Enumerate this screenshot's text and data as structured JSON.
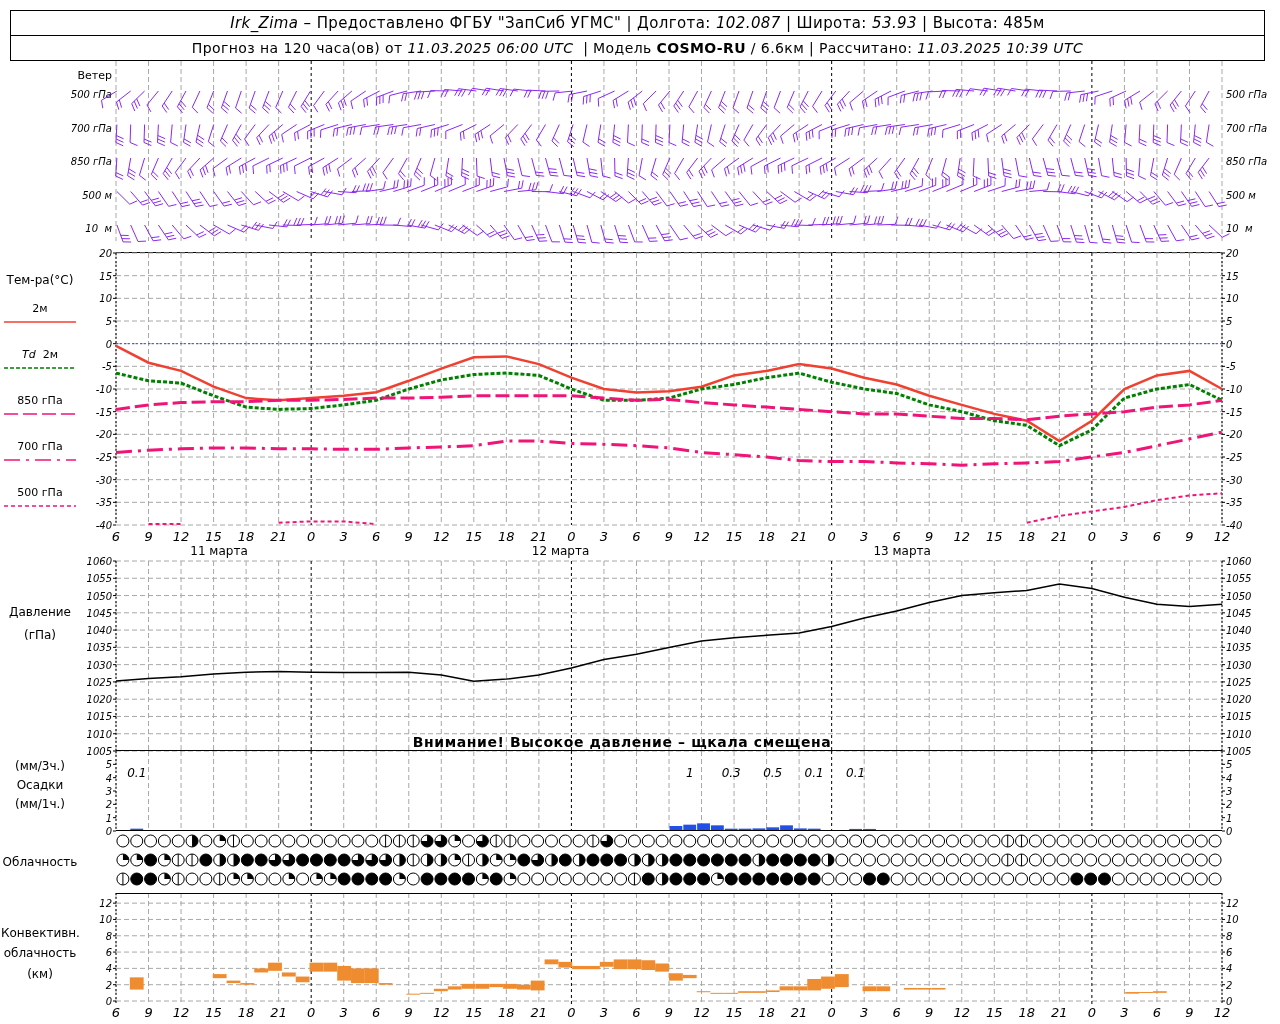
{
  "header": {
    "line_1": "*Irk_Zima* – Предоставлено ФГБУ \"ЗапСиб УГМС\" | Долгота: *102.087* | Широта: *53.93* | Высота: 485м",
    "line_2": "Прогноз на 120 часа(ов) от *11.03.2025 06:00 UTC*  | Модель **COSMO-RU** / 6.6км | Рассчитано: *11.03.2025 10:39 UTC*"
  },
  "wind": {
    "title": "Ветер",
    "rows": [
      {
        "label_left": "500 гПа",
        "label_right": "500 гПа"
      },
      {
        "label_left": "700 гПа",
        "label_right": "700 гПа"
      },
      {
        "label_left": "850 гПа",
        "label_right": "850 гПа"
      },
      {
        "label_left": "500 м",
        "label_right": "500 м"
      },
      {
        "label_left": "10  м",
        "label_right": "10  м"
      }
    ]
  },
  "temperature": {
    "right_axis_labels": [
      "20",
      "15",
      "10",
      "5",
      "0",
      "-5",
      "-10",
      "-15",
      "-20",
      "-25",
      "-30",
      "-35",
      "-40"
    ],
    "dates": [
      "11 марта",
      "12 марта",
      "13 марта"
    ],
    "chart_data": {
      "type": "line",
      "title": "Тем-ра(°C)",
      "grid": true,
      "ref_lines": [
        {
          "axis": "y",
          "value": 0,
          "color": "#3050ff"
        }
      ],
      "ylim": [
        -40,
        20
      ],
      "yticks": [
        20,
        15,
        10,
        5,
        0,
        -5,
        -10,
        -15,
        -20,
        -25,
        -30,
        -35,
        -40
      ],
      "categories": [
        "6",
        "9",
        "12",
        "15",
        "18",
        "21",
        "0",
        "3",
        "6",
        "9",
        "12",
        "15",
        "18",
        "21",
        "0",
        "3",
        "6",
        "9",
        "12",
        "15",
        "18",
        "21",
        "0",
        "3",
        "6",
        "9",
        "12",
        "15",
        "18",
        "21",
        "0",
        "3",
        "6",
        "9",
        "12"
      ],
      "series": [
        {
          "name": "2м",
          "color": "#f04030",
          "line_style": "solid",
          "values": [
            -0.5,
            -4.2,
            -6,
            -9.5,
            -12,
            -12.5,
            -12,
            -11.5,
            -10.7,
            -8.2,
            -5.5,
            -3,
            -2.8,
            -4.5,
            -7.5,
            -10,
            -10.8,
            -10.5,
            -9.5,
            -7,
            -6,
            -4.5,
            -5.5,
            -7.5,
            -9,
            -11.5,
            -13.5,
            -15.5,
            -17,
            -21.5,
            -17,
            -10,
            -7,
            -6,
            -10
          ]
        },
        {
          "name": "*Td*  2м",
          "color": "#008000",
          "line_style": "dotted",
          "values": [
            -6.5,
            -8.2,
            -8.7,
            -11.5,
            -14,
            -14.5,
            -14.3,
            -13.5,
            -12.5,
            -10,
            -8,
            -6.8,
            -6.5,
            -7,
            -10,
            -12.5,
            -12.5,
            -12,
            -10,
            -9,
            -7.5,
            -6.5,
            -8.5,
            -10,
            -11,
            -13.5,
            -15,
            -17,
            -18,
            -22.5,
            -19,
            -12,
            -10,
            -9,
            -12.5
          ]
        },
        {
          "name": "850 гПа",
          "color": "#f01478",
          "line_style": "dashed",
          "values": [
            -14.5,
            -13.5,
            -13,
            -12.8,
            -12.8,
            -12.5,
            -12.5,
            -12.3,
            -12,
            -12,
            -11.8,
            -11.5,
            -11.5,
            -11.5,
            -11.5,
            -12,
            -12.5,
            -12.3,
            -13,
            -13.5,
            -14,
            -14.5,
            -15,
            -15.5,
            -15.5,
            -16,
            -16.5,
            -16.5,
            -16.8,
            -16,
            -15.5,
            -15,
            -14,
            -13.5,
            -12.5
          ]
        },
        {
          "name": "700 гПа",
          "color": "#f01478",
          "line_style": "dashdot",
          "values": [
            -24,
            -23.5,
            -23.2,
            -23,
            -23,
            -23.2,
            -23.2,
            -23.3,
            -23.3,
            -23,
            -22.8,
            -22.5,
            -21.5,
            -21.5,
            -22,
            -22.2,
            -22.5,
            -23,
            -24,
            -24.5,
            -25,
            -25.8,
            -26,
            -26,
            -26.3,
            -26.5,
            -26.8,
            -26.5,
            -26.3,
            -26,
            -25,
            -24,
            -22.5,
            -21,
            -19.5
          ]
        },
        {
          "name": "500 гПа",
          "color": "#f01478",
          "line_style": "fine",
          "values": [
            null,
            -39.8,
            -39.8,
            null,
            null,
            -39.5,
            -39.2,
            -39.2,
            -39.8,
            null,
            null,
            null,
            null,
            null,
            null,
            null,
            null,
            null,
            null,
            null,
            null,
            null,
            null,
            null,
            null,
            null,
            null,
            null,
            -39.5,
            -38,
            -37,
            -36,
            -34.5,
            -33.5,
            -33
          ]
        }
      ]
    }
  },
  "pressure": {
    "right_axis_labels": [
      "1060",
      "1055",
      "1050",
      "1045",
      "1040",
      "1035",
      "1030",
      "1025",
      "1020",
      "1015",
      "1010",
      "1005"
    ],
    "chart_data": {
      "type": "line",
      "title": "Давление",
      "ylabel": "(гПа)",
      "grid": true,
      "ylim": [
        1005,
        1060
      ],
      "yticks": [
        1060,
        1055,
        1050,
        1045,
        1040,
        1035,
        1030,
        1025,
        1020,
        1015,
        1010,
        1005
      ],
      "series": [
        {
          "values": [
            1025.3,
            1026,
            1026.5,
            1027.3,
            1027.8,
            1028,
            1027.8,
            1027.7,
            1027.7,
            1027.8,
            1027,
            1025.2,
            1025.8,
            1027,
            1029,
            1031.5,
            1033,
            1035,
            1036.8,
            1037.8,
            1038.5,
            1039.2,
            1041,
            1043.5,
            1045.5,
            1048,
            1050,
            1050.8,
            1051.5,
            1053.3,
            1052,
            1049.5,
            1047.5,
            1046.8,
            1047.5
          ]
        }
      ]
    },
    "warning": "Внимание! Высокое давление – щкала смещена"
  },
  "precipitation": {
    "label_top": "(мм/3ч.)",
    "right_axis_labels": [
      "5",
      "4",
      "3",
      "2",
      "1",
      "0"
    ],
    "chart_data": {
      "type": "bar",
      "title": "Осадки",
      "ylabel": "(мм/1ч.)",
      "grid": true,
      "ylim": [
        0,
        6
      ],
      "yticks": [
        0,
        1,
        2,
        3,
        4,
        5
      ],
      "values": [
        0,
        0.1,
        0,
        0,
        0,
        0,
        0,
        0,
        0,
        0,
        0,
        0,
        0,
        0,
        0,
        0,
        0,
        0,
        0,
        0,
        0,
        0,
        0,
        0,
        0,
        0,
        0,
        0,
        0,
        0,
        0,
        0,
        0,
        0,
        0,
        0,
        0,
        0,
        0,
        0,
        0.3,
        0.4,
        0.5,
        0.35,
        0.1,
        0.1,
        0.12,
        0.2,
        0.35,
        0.12,
        0.1,
        0,
        0,
        0.08,
        0.08,
        0,
        0,
        0,
        0,
        0,
        0,
        0,
        0,
        0,
        0,
        0,
        0,
        0,
        0,
        0,
        0,
        0,
        0,
        0,
        0,
        0,
        0,
        0,
        0,
        0
      ],
      "annotations": [
        "0.1",
        "1",
        "0.3",
        "0.5",
        "0.1",
        "0.1"
      ]
    }
  },
  "cloudiness": {
    "label": "Облачность",
    "rows": [
      {
        "cells": [
          {
            "kind": "clear"
          },
          {
            "kind": "clear"
          },
          {
            "kind": "clear"
          },
          {
            "kind": "clear"
          },
          {
            "kind": "clear"
          },
          {
            "kind": "half"
          },
          {
            "kind": "clear"
          },
          {
            "kind": "quarter"
          },
          {
            "kind": "line"
          },
          {
            "kind": "clear"
          },
          {
            "kind": "clear"
          },
          {
            "kind": "clear"
          },
          {
            "kind": "clear"
          },
          {
            "kind": "clear"
          },
          {
            "kind": "clear"
          },
          {
            "kind": "clear"
          },
          {
            "kind": "clear"
          },
          {
            "kind": "clear"
          },
          {
            "kind": "clear"
          },
          {
            "kind": "line"
          },
          {
            "kind": "line"
          },
          {
            "kind": "line"
          },
          {
            "kind": "threequarter"
          },
          {
            "kind": "threequarter"
          },
          {
            "kind": "quarter"
          },
          {
            "kind": "clear"
          },
          {
            "kind": "threequarter"
          },
          {
            "kind": "line"
          },
          {
            "kind": "line"
          },
          {
            "kind": "clear"
          },
          {
            "kind": "clear"
          },
          {
            "kind": "clear"
          },
          {
            "kind": "clear"
          },
          {
            "kind": "clear"
          },
          {
            "kind": "line"
          },
          {
            "kind": "threequarter"
          },
          {
            "kind": "clear"
          },
          {
            "kind": "clear"
          },
          {
            "kind": "clear"
          },
          {
            "kind": "clear"
          },
          {
            "kind": "clear"
          },
          {
            "kind": "clear"
          },
          {
            "kind": "clear"
          },
          {
            "kind": "clear"
          },
          {
            "kind": "clear"
          },
          {
            "kind": "clear"
          },
          {
            "kind": "clear"
          },
          {
            "kind": "clear"
          },
          {
            "kind": "clear"
          },
          {
            "kind": "clear"
          },
          {
            "kind": "clear"
          },
          {
            "kind": "clear"
          },
          {
            "kind": "clear"
          },
          {
            "kind": "clear"
          },
          {
            "kind": "clear"
          },
          {
            "kind": "clear"
          },
          {
            "kind": "clear"
          },
          {
            "kind": "clear"
          },
          {
            "kind": "clear"
          },
          {
            "kind": "clear"
          },
          {
            "kind": "clear"
          },
          {
            "kind": "clear"
          },
          {
            "kind": "clear"
          },
          {
            "kind": "clear"
          },
          {
            "kind": "line"
          },
          {
            "kind": "line"
          },
          {
            "kind": "clear"
          },
          {
            "kind": "clear"
          },
          {
            "kind": "clear"
          },
          {
            "kind": "clear"
          },
          {
            "kind": "clear"
          },
          {
            "kind": "clear"
          },
          {
            "kind": "clear"
          },
          {
            "kind": "clear"
          },
          {
            "kind": "clear"
          },
          {
            "kind": "clear"
          },
          {
            "kind": "clear"
          },
          {
            "kind": "clear"
          },
          {
            "kind": "clear"
          },
          {
            "kind": "clear"
          }
        ]
      },
      {
        "cells": [
          {
            "kind": "quarter"
          },
          {
            "kind": "quarter"
          },
          {
            "kind": "full"
          },
          {
            "kind": "quarter"
          },
          {
            "kind": "line"
          },
          {
            "kind": "line"
          },
          {
            "kind": "full"
          },
          {
            "kind": "half"
          },
          {
            "kind": "half"
          },
          {
            "kind": "full"
          },
          {
            "kind": "full"
          },
          {
            "kind": "threequarter"
          },
          {
            "kind": "threequarter"
          },
          {
            "kind": "full"
          },
          {
            "kind": "full"
          },
          {
            "kind": "full"
          },
          {
            "kind": "full"
          },
          {
            "kind": "threequarter"
          },
          {
            "kind": "threequarter"
          },
          {
            "kind": "threequarter"
          },
          {
            "kind": "half"
          },
          {
            "kind": "line"
          },
          {
            "kind": "half"
          },
          {
            "kind": "half"
          },
          {
            "kind": "quarter"
          },
          {
            "kind": "line"
          },
          {
            "kind": "half"
          },
          {
            "kind": "quarter"
          },
          {
            "kind": "quarter"
          },
          {
            "kind": "full"
          },
          {
            "kind": "threequarter"
          },
          {
            "kind": "half"
          },
          {
            "kind": "full"
          },
          {
            "kind": "half"
          },
          {
            "kind": "full"
          },
          {
            "kind": "full"
          },
          {
            "kind": "full"
          },
          {
            "kind": "half"
          },
          {
            "kind": "half"
          },
          {
            "kind": "half"
          },
          {
            "kind": "full"
          },
          {
            "kind": "full"
          },
          {
            "kind": "full"
          },
          {
            "kind": "full"
          },
          {
            "kind": "full"
          },
          {
            "kind": "full"
          },
          {
            "kind": "half"
          },
          {
            "kind": "full"
          },
          {
            "kind": "full"
          },
          {
            "kind": "full"
          },
          {
            "kind": "full"
          },
          {
            "kind": "half"
          },
          {
            "kind": "clear"
          },
          {
            "kind": "clear"
          },
          {
            "kind": "clear"
          },
          {
            "kind": "clear"
          },
          {
            "kind": "clear"
          },
          {
            "kind": "clear"
          },
          {
            "kind": "clear"
          },
          {
            "kind": "clear"
          },
          {
            "kind": "clear"
          },
          {
            "kind": "clear"
          },
          {
            "kind": "clear"
          },
          {
            "kind": "clear"
          },
          {
            "kind": "line"
          },
          {
            "kind": "line"
          },
          {
            "kind": "clear"
          },
          {
            "kind": "clear"
          },
          {
            "kind": "clear"
          },
          {
            "kind": "clear"
          },
          {
            "kind": "clear"
          },
          {
            "kind": "clear"
          },
          {
            "kind": "clear"
          },
          {
            "kind": "clear"
          },
          {
            "kind": "clear"
          },
          {
            "kind": "clear"
          },
          {
            "kind": "clear"
          },
          {
            "kind": "clear"
          },
          {
            "kind": "clear"
          },
          {
            "kind": "clear"
          }
        ]
      },
      {
        "cells": [
          {
            "kind": "line"
          },
          {
            "kind": "full"
          },
          {
            "kind": "full"
          },
          {
            "kind": "quarter"
          },
          {
            "kind": "line"
          },
          {
            "kind": "clear"
          },
          {
            "kind": "clear"
          },
          {
            "kind": "line"
          },
          {
            "kind": "quarter"
          },
          {
            "kind": "quarter"
          },
          {
            "kind": "clear"
          },
          {
            "kind": "clear"
          },
          {
            "kind": "quarter"
          },
          {
            "kind": "clear"
          },
          {
            "kind": "quarter"
          },
          {
            "kind": "quarter"
          },
          {
            "kind": "full"
          },
          {
            "kind": "full"
          },
          {
            "kind": "full"
          },
          {
            "kind": "full"
          },
          {
            "kind": "quarter"
          },
          {
            "kind": "clear"
          },
          {
            "kind": "full"
          },
          {
            "kind": "full"
          },
          {
            "kind": "full"
          },
          {
            "kind": "full"
          },
          {
            "kind": "quarter"
          },
          {
            "kind": "full"
          },
          {
            "kind": "quarter"
          },
          {
            "kind": "clear"
          },
          {
            "kind": "clear"
          },
          {
            "kind": "clear"
          },
          {
            "kind": "clear"
          },
          {
            "kind": "clear"
          },
          {
            "kind": "clear"
          },
          {
            "kind": "clear"
          },
          {
            "kind": "clear"
          },
          {
            "kind": "line"
          },
          {
            "kind": "full"
          },
          {
            "kind": "half"
          },
          {
            "kind": "full"
          },
          {
            "kind": "full"
          },
          {
            "kind": "full"
          },
          {
            "kind": "quarter"
          },
          {
            "kind": "full"
          },
          {
            "kind": "full"
          },
          {
            "kind": "full"
          },
          {
            "kind": "full"
          },
          {
            "kind": "full"
          },
          {
            "kind": "full"
          },
          {
            "kind": "full"
          },
          {
            "kind": "clear"
          },
          {
            "kind": "clear"
          },
          {
            "kind": "clear"
          },
          {
            "kind": "full"
          },
          {
            "kind": "full"
          },
          {
            "kind": "clear"
          },
          {
            "kind": "clear"
          },
          {
            "kind": "clear"
          },
          {
            "kind": "clear"
          },
          {
            "kind": "clear"
          },
          {
            "kind": "clear"
          },
          {
            "kind": "clear"
          },
          {
            "kind": "clear"
          },
          {
            "kind": "clear"
          },
          {
            "kind": "clear"
          },
          {
            "kind": "clear"
          },
          {
            "kind": "clear"
          },
          {
            "kind": "clear"
          },
          {
            "kind": "full"
          },
          {
            "kind": "full"
          },
          {
            "kind": "full"
          },
          {
            "kind": "clear"
          },
          {
            "kind": "clear"
          },
          {
            "kind": "clear"
          },
          {
            "kind": "clear"
          },
          {
            "kind": "clear"
          },
          {
            "kind": "clear"
          },
          {
            "kind": "clear"
          },
          {
            "kind": "clear"
          }
        ]
      }
    ]
  },
  "convective": {
    "right_axis_labels": [
      "12",
      "10",
      "8",
      "6",
      "4",
      "2",
      "0"
    ],
    "axis_labels": [
      "6",
      "9",
      "12",
      "15",
      "18",
      "21",
      "0",
      "3",
      "6",
      "9",
      "12",
      "15",
      "18",
      "21",
      "0",
      "3",
      "6",
      "9",
      "12",
      "15",
      "18",
      "21",
      "0",
      "3",
      "6",
      "9",
      "12",
      "15",
      "18",
      "21",
      "0",
      "3",
      "6",
      "9",
      "12"
    ],
    "chart_data": {
      "type": "candlestick",
      "title": "Конвективн. облачность",
      "ylabel": "(км)",
      "grid": true,
      "ylim": [
        0,
        13
      ],
      "yticks": [
        0,
        2,
        4,
        6,
        8,
        10,
        12
      ],
      "ohlc": [
        null,
        [
          1.4,
          2.9,
          1.4,
          2.9
        ],
        null,
        null,
        null,
        null,
        null,
        [
          2.8,
          3.3,
          2.8,
          3.3
        ],
        [
          2.2,
          2.5,
          2.2,
          2.5
        ],
        [
          2.0,
          2.2,
          2.0,
          2.2
        ],
        [
          3.5,
          4.0,
          3.5,
          4.0
        ],
        [
          3.7,
          4.7,
          3.7,
          4.7
        ],
        [
          3.0,
          3.5,
          3.0,
          3.5
        ],
        [
          2.3,
          3.0,
          2.3,
          3.0
        ],
        [
          3.6,
          4.7,
          3.6,
          4.7
        ],
        [
          3.6,
          4.7,
          3.6,
          4.7
        ],
        [
          2.5,
          4.3,
          2.5,
          4.3
        ],
        [
          2.2,
          4.0,
          2.2,
          4.0
        ],
        [
          2.2,
          4.0,
          2.2,
          4.0
        ],
        [
          2.0,
          2.2,
          2.0,
          2.2
        ],
        null,
        [
          0.8,
          0.9,
          0.8,
          0.9
        ],
        [
          0.9,
          1.0,
          0.9,
          1.0
        ],
        [
          1.2,
          1.5,
          1.2,
          1.5
        ],
        [
          1.4,
          1.8,
          1.4,
          1.8
        ],
        [
          1.5,
          2.1,
          1.5,
          2.1
        ],
        [
          1.5,
          2.1,
          1.5,
          2.1
        ],
        [
          1.7,
          2.1,
          1.7,
          2.1
        ],
        [
          1.5,
          2.1,
          1.5,
          2.1
        ],
        [
          1.4,
          2.0,
          1.4,
          2.0
        ],
        [
          1.3,
          2.5,
          1.3,
          2.5
        ],
        [
          4.5,
          5.1,
          4.5,
          5.1
        ],
        [
          4.1,
          4.8,
          4.1,
          4.8
        ],
        [
          3.9,
          4.3,
          3.9,
          4.3
        ],
        [
          3.9,
          4.3,
          3.9,
          4.3
        ],
        [
          4.2,
          4.8,
          4.2,
          4.8
        ],
        [
          3.9,
          5.1,
          3.9,
          5.1
        ],
        [
          3.9,
          5.1,
          3.9,
          5.1
        ],
        [
          3.8,
          5.0,
          3.8,
          5.0
        ],
        [
          3.6,
          4.6,
          3.6,
          4.6
        ],
        [
          2.5,
          3.4,
          2.5,
          3.4
        ],
        [
          2.8,
          3.2,
          2.8,
          3.2
        ],
        [
          1.1,
          1.2,
          1.1,
          1.2
        ],
        [
          0.9,
          1.0,
          0.9,
          1.0
        ],
        [
          0.9,
          1.0,
          0.9,
          1.0
        ],
        [
          1.0,
          1.2,
          1.0,
          1.2
        ],
        [
          1.0,
          1.2,
          1.0,
          1.2
        ],
        [
          1.1,
          1.3,
          1.1,
          1.3
        ],
        [
          1.3,
          1.8,
          1.3,
          1.8
        ],
        [
          1.3,
          1.8,
          1.3,
          1.8
        ],
        [
          1.3,
          2.7,
          1.3,
          2.7
        ],
        [
          1.5,
          3.0,
          1.5,
          3.0
        ],
        [
          1.7,
          3.3,
          1.7,
          3.3
        ],
        null,
        [
          1.2,
          1.8,
          1.2,
          1.8
        ],
        [
          1.2,
          1.8,
          1.2,
          1.8
        ],
        null,
        [
          1.4,
          1.6,
          1.4,
          1.6
        ],
        [
          1.4,
          1.6,
          1.4,
          1.6
        ],
        [
          1.4,
          1.6,
          1.4,
          1.6
        ],
        null,
        null,
        null,
        null,
        null,
        null,
        null,
        null,
        null,
        null,
        null,
        null,
        null,
        [
          0.9,
          1.1,
          0.9,
          1.1
        ],
        [
          1.0,
          1.1,
          1.0,
          1.1
        ],
        [
          1.0,
          1.2,
          1.0,
          1.2
        ],
        null,
        null,
        null,
        null
      ]
    }
  }
}
